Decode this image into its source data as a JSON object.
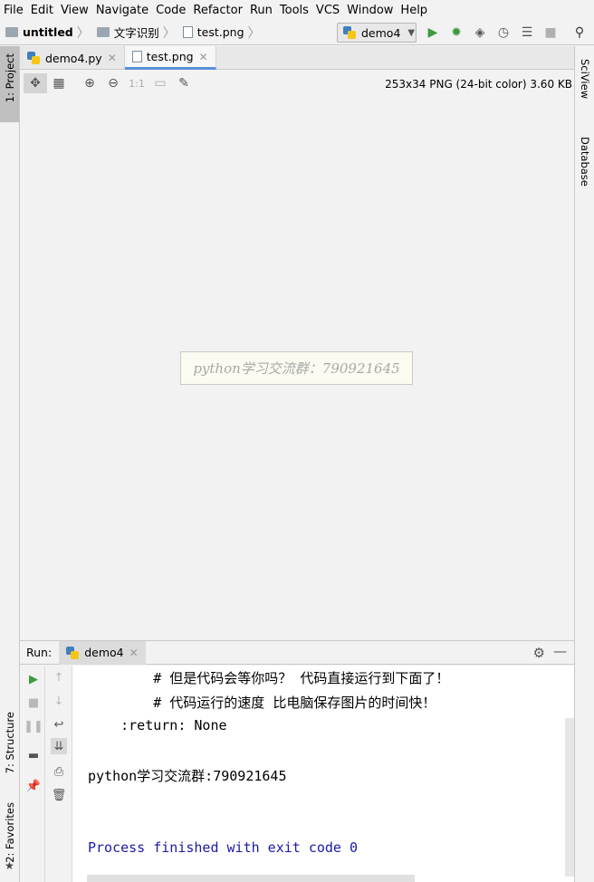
{
  "menu": [
    "File",
    "Edit",
    "View",
    "Navigate",
    "Code",
    "Refactor",
    "Run",
    "Tools",
    "VCS",
    "Window",
    "Help"
  ],
  "breadcrumb": {
    "project": "untitled",
    "folder": "文字识别",
    "file": "test.png"
  },
  "run_config": "demo4",
  "left_tabs": {
    "project": "1: Project",
    "structure": "7: Structure",
    "favorites": "2: Favorites"
  },
  "right_tabs": {
    "sciview": "SciView",
    "database": "Database"
  },
  "tabs": [
    {
      "label": "demo4.py"
    },
    {
      "label": "test.png"
    }
  ],
  "image_tools": {
    "ratio_label": "1:1",
    "info": "253x34 PNG (24-bit color) 3.60 KB"
  },
  "image_content": "python学习交流群：790921645",
  "run_panel": {
    "title": "Run:",
    "tab": "demo4"
  },
  "console": {
    "lines": [
      "        # 但是代码会等你吗？ 代码直接运行到下面了！",
      "        # 代码运行的速度 比电脑保存图片的时间快！",
      "    :return: None",
      "",
      "python学习交流群:790921645",
      "",
      "",
      "Process finished with exit code 0"
    ],
    "colors": {
      "normal": "#000000",
      "process": "#1a1aa6"
    }
  }
}
